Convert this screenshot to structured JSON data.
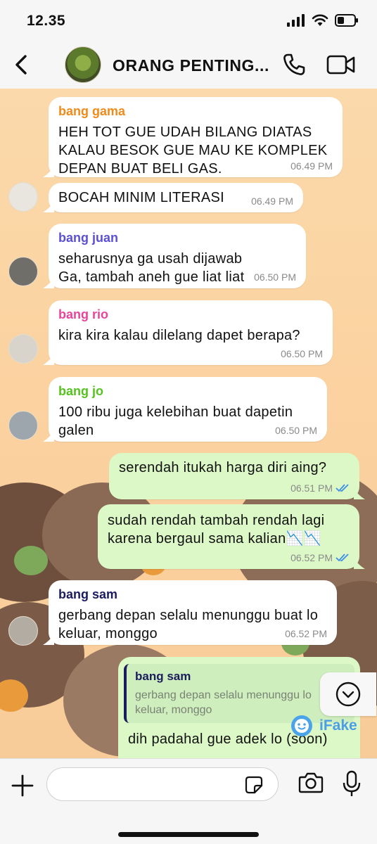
{
  "status_bar": {
    "time": "12.35"
  },
  "header": {
    "title": "ORANG PENTING...",
    "back_icon": "chevron-left-icon",
    "call_icon": "phone-icon",
    "video_icon": "video-camera-icon"
  },
  "colors": {
    "gama": "#f08a1a",
    "juan": "#5b4fd6",
    "rio": "#e8459a",
    "jo": "#55c21f",
    "sam": "#1b1c5e",
    "check": "#3b8ee8",
    "outgoing": "#dcf8c6"
  },
  "messages": [
    {
      "sender": "bang gama",
      "text": "HEH TOT GUE UDAH BILANG DIATAS KALAU BESOK GUE MAU KE KOMPLEK DEPAN BUAT BELI GAS.",
      "time": "06.49 PM"
    },
    {
      "text": "BOCAH MINIM LITERASI",
      "time": "06.49 PM"
    },
    {
      "sender": "bang juan",
      "text": "seharusnya ga usah dijawab Ga, tambah aneh gue liat liat",
      "time": "06.50 PM"
    },
    {
      "sender": "bang rio",
      "text": "kira kira kalau dilelang dapet berapa?",
      "time": "06.50 PM"
    },
    {
      "sender": "bang jo",
      "text": "100 ribu juga kelebihan buat dapetin galen",
      "time": "06.50 PM"
    },
    {
      "text": "serendah itukah harga diri aing?",
      "time": "06.51 PM",
      "outgoing": true
    },
    {
      "text": "sudah rendah tambah rendah lagi karena bergaul sama kalian📉📉",
      "time": "06.52 PM",
      "outgoing": true
    },
    {
      "sender": "bang sam",
      "text": "gerbang depan selalu menunggu buat lo keluar, monggo",
      "time": "06.52 PM"
    },
    {
      "quote_sender": "bang sam",
      "quote_text": "gerbang depan selalu menunggu lo keluar, monggo",
      "text": "dih padahal gue adek lo (soon)",
      "outgoing": true
    }
  ],
  "watermark": {
    "label": "iFake"
  },
  "composer": {
    "placeholder": "",
    "icons": [
      "plus-icon",
      "sticker-icon",
      "camera-icon",
      "microphone-icon"
    ]
  }
}
